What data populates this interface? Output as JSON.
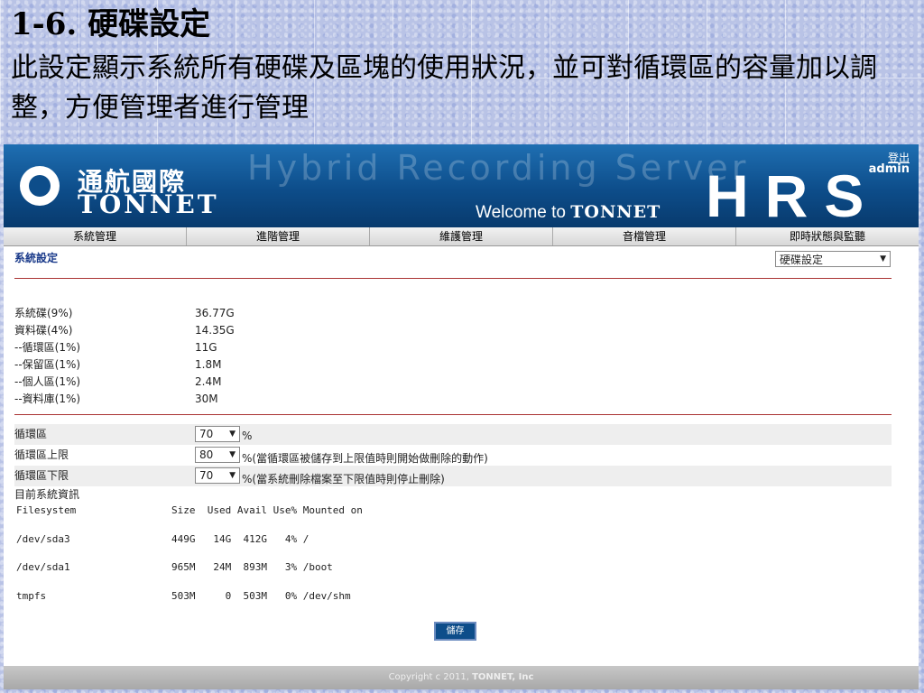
{
  "slide": {
    "title": "1-6. 硬碟設定",
    "subtitle": "此設定顯示系統所有硬碟及區塊的使用狀況，並可對循環區的容量加以調整，方便管理者進行管理"
  },
  "header": {
    "logo_cn": "通航國際",
    "logo_en": "TONNET",
    "ghost_text": "Hybrid Recording Server",
    "welcome_prefix": "Welcome to ",
    "welcome_brand": "TONNET",
    "product": "HRS",
    "logout": "登出",
    "user": "admin"
  },
  "nav": [
    "系統管理",
    "進階管理",
    "維護管理",
    "音檔管理",
    "即時狀態與監聽"
  ],
  "section": {
    "title": "系統設定",
    "dropdown_value": "硬碟設定"
  },
  "usage": [
    {
      "label": "系統碟(9%)",
      "value": "36.77G"
    },
    {
      "label": "資料碟(4%)",
      "value": "14.35G"
    },
    {
      "label": "--循環區(1%)",
      "value": "11G"
    },
    {
      "label": "--保留區(1%)",
      "value": "1.8M"
    },
    {
      "label": "--個人區(1%)",
      "value": "2.4M"
    },
    {
      "label": "--資料庫(1%)",
      "value": "30M"
    }
  ],
  "settings": [
    {
      "label": "循環區",
      "value": "70",
      "note": "%"
    },
    {
      "label": "循環區上限",
      "value": "80",
      "note": "%(當循環區被儲存到上限值時則開始做刪除的動作)"
    },
    {
      "label": "循環區下限",
      "value": "70",
      "note": "%(當系統刪除檔案至下限值時則停止刪除)"
    }
  ],
  "sysinfo": {
    "label": "目前系統資訊",
    "header": [
      "Filesystem",
      "Size  Used Avail Use% Mounted on"
    ],
    "rows": [
      [
        "/dev/sda3",
        "449G   14G  412G   4% /"
      ],
      [
        "/dev/sda1",
        "965M   24M  893M   3% /boot"
      ],
      [
        "tmpfs",
        "503M     0  503M   0% /dev/shm"
      ]
    ]
  },
  "save_label": "儲存",
  "footer": {
    "prefix": "Copyright c 2011, ",
    "brand": "TONNET, Inc"
  }
}
